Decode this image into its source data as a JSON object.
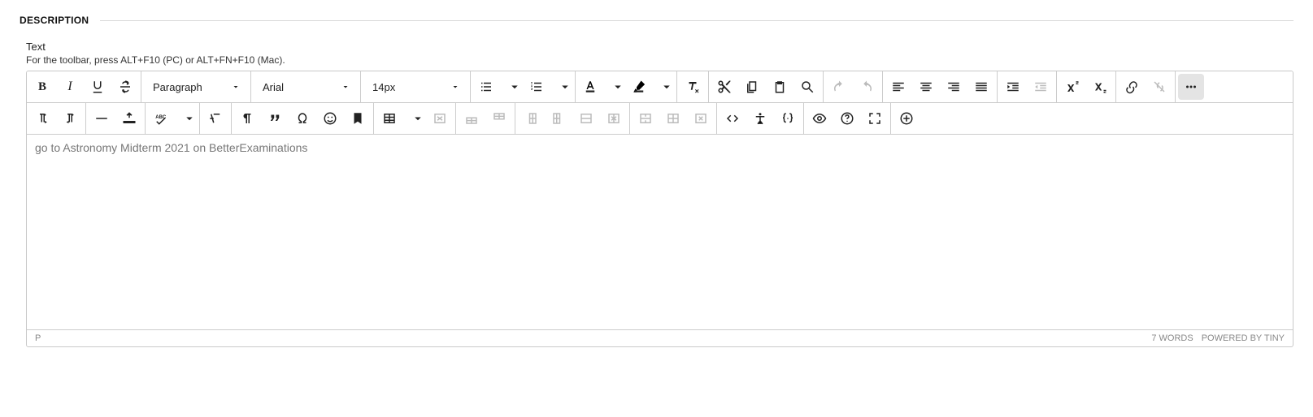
{
  "section": {
    "title": "DESCRIPTION"
  },
  "field": {
    "label": "Text",
    "help": "For the toolbar, press ALT+F10 (PC) or ALT+FN+F10 (Mac)."
  },
  "toolbar": {
    "block_format": "Paragraph",
    "font_family": "Arial",
    "font_size": "14px"
  },
  "content": "go to Astronomy Midterm 2021 on BetterExaminations",
  "statusbar": {
    "path": "P",
    "wordcount": "7 WORDS",
    "credit": "POWERED BY TINY"
  }
}
